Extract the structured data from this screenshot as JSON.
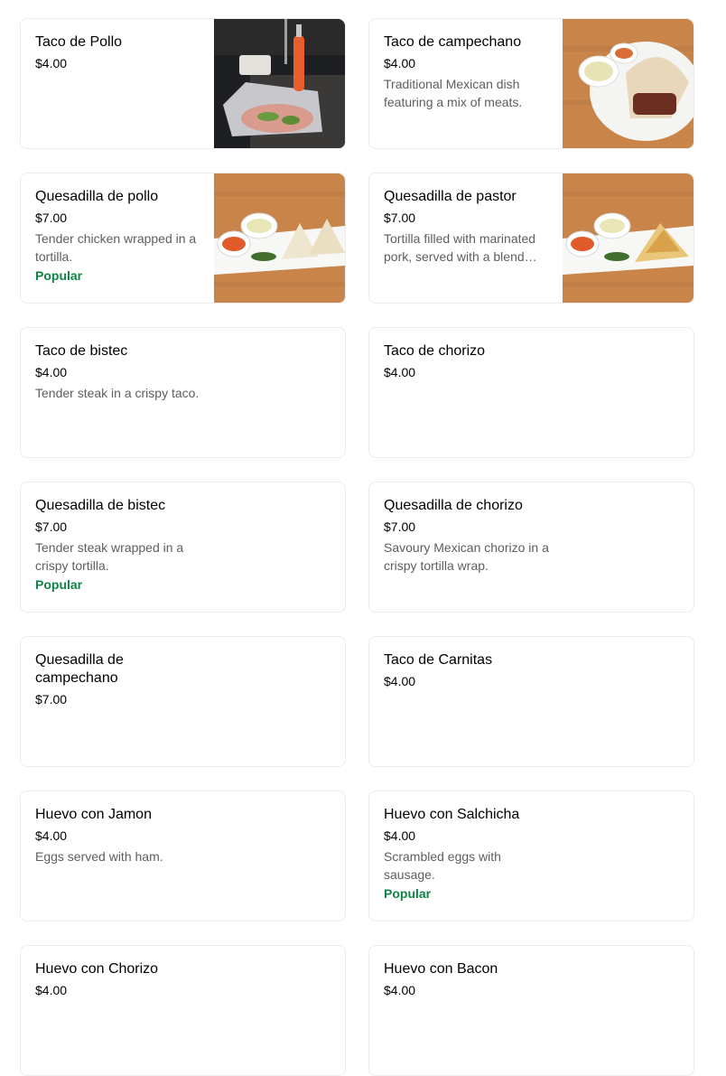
{
  "items": [
    {
      "name": "Taco de Pollo",
      "price": "$4.00",
      "desc": "",
      "badge": "",
      "image_icon": "taco-in-foil-photo"
    },
    {
      "name": "Taco de campechano",
      "price": "$4.00",
      "desc": "Traditional Mexican dish featuring a mix of meats.",
      "badge": "",
      "image_icon": "taco-plate-photo"
    },
    {
      "name": "Quesadilla de pollo",
      "price": "$7.00",
      "desc": "Tender chicken wrapped in a tortilla.",
      "badge": "Popular",
      "image_icon": "quesadilla-plate-photo"
    },
    {
      "name": "Quesadilla de pastor",
      "price": "$7.00",
      "desc": "Tortilla filled with marinated pork, served with a blend of…",
      "badge": "",
      "image_icon": "quesadilla-plate-photo"
    },
    {
      "name": "Taco de bistec",
      "price": "$4.00",
      "desc": "Tender steak in a crispy taco.",
      "badge": ""
    },
    {
      "name": "Taco de chorizo",
      "price": "$4.00",
      "desc": "",
      "badge": ""
    },
    {
      "name": "Quesadilla de bistec",
      "price": "$7.00",
      "desc": "Tender steak wrapped in a crispy tortilla.",
      "badge": "Popular"
    },
    {
      "name": "Quesadilla de chorizo",
      "price": "$7.00",
      "desc": "Savoury Mexican chorizo in a crispy tortilla wrap.",
      "badge": ""
    },
    {
      "name": "Quesadilla de campechano",
      "price": "$7.00",
      "desc": "",
      "badge": ""
    },
    {
      "name": "Taco de Carnitas",
      "price": "$4.00",
      "desc": "",
      "badge": ""
    },
    {
      "name": "Huevo con Jamon",
      "price": "$4.00",
      "desc": "Eggs served with ham.",
      "badge": ""
    },
    {
      "name": "Huevo con Salchicha",
      "price": "$4.00",
      "desc": "Scrambled eggs with sausage.",
      "badge": "Popular"
    },
    {
      "name": "Huevo con Chorizo",
      "price": "$4.00",
      "desc": "",
      "badge": ""
    },
    {
      "name": "Huevo con Bacon",
      "price": "$4.00",
      "desc": "",
      "badge": ""
    }
  ],
  "colors": {
    "popular": "#0e8345",
    "border": "#ececec",
    "muted": "#5e5e5e"
  }
}
